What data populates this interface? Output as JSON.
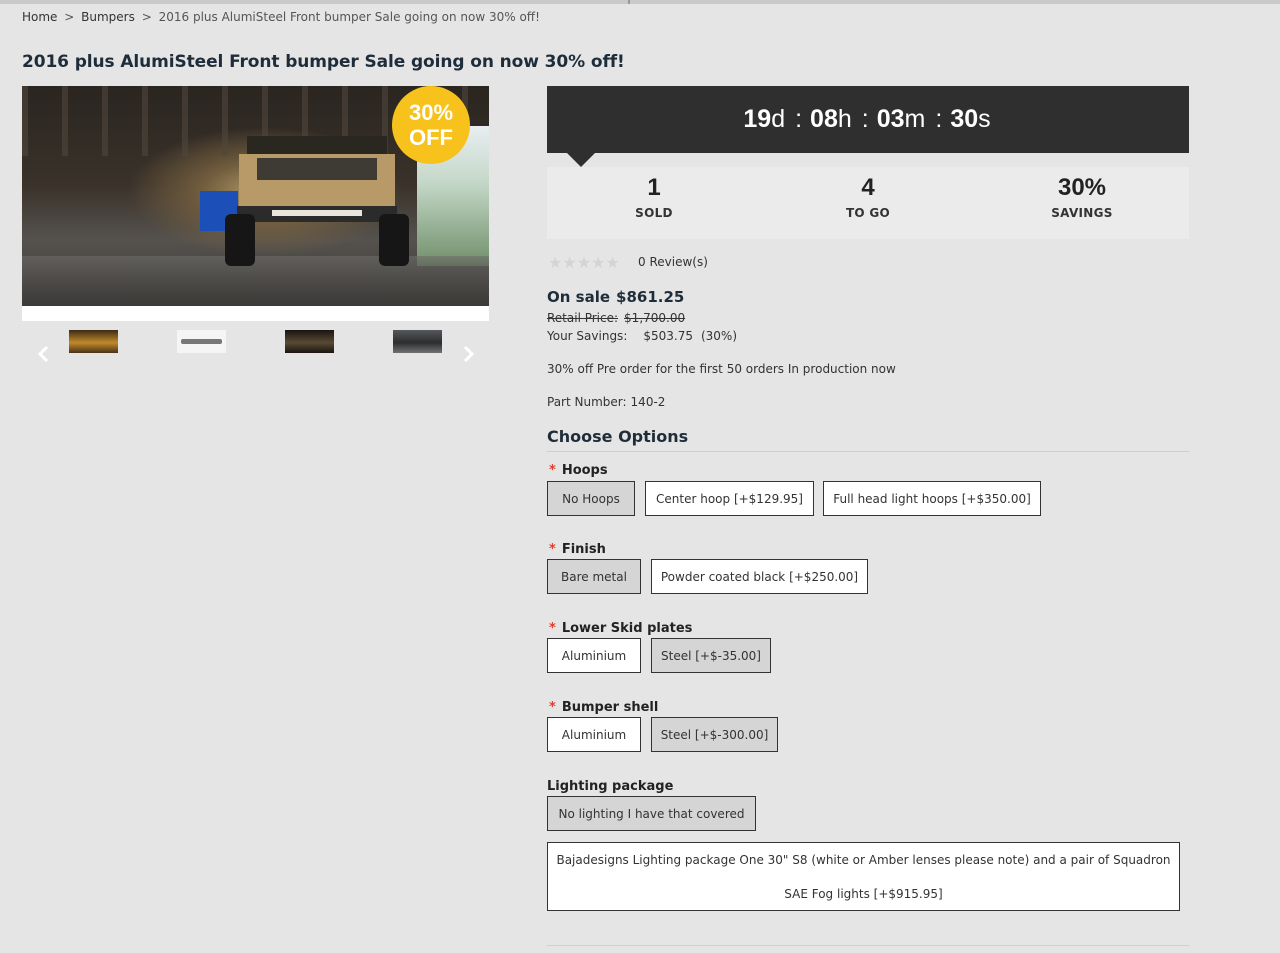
{
  "breadcrumb": {
    "home": "Home",
    "sep1": ">",
    "category": "Bumpers",
    "sep2": ">",
    "current": "2016 plus AlumiSteel Front bumper Sale going on now 30% off!"
  },
  "product": {
    "title": "2016 plus AlumiSteel Front bumper Sale going on now 30% off!",
    "badge_line1": "30%",
    "badge_line2": "OFF"
  },
  "gallery": {
    "prev_icon": "chevron-left-icon",
    "next_icon": "chevron-right-icon",
    "thumbnail_count": 4
  },
  "countdown": {
    "days": "19",
    "days_unit": "d",
    "hours": "08",
    "hours_unit": "h",
    "minutes": "03",
    "minutes_unit": "m",
    "seconds": "30",
    "seconds_unit": "s",
    "separator": ":"
  },
  "stats": [
    {
      "value": "1",
      "label": "SOLD"
    },
    {
      "value": "4",
      "label": "TO GO"
    },
    {
      "value": "30%",
      "label": "SAVINGS"
    }
  ],
  "rating": {
    "stars": "★★★★★",
    "stars_filled": 0,
    "reviews": "0 Review(s)"
  },
  "pricing": {
    "on_sale_label": "On sale",
    "on_sale_price": "$861.25",
    "retail_label": "Retail Price:",
    "retail_price": "$1,700.00",
    "savings_label": "Your Savings:",
    "savings_amount": "$503.75",
    "savings_percent": "(30%)"
  },
  "description": "30% off Pre order for the first 50 orders In production now",
  "part_number": {
    "label": "Part Number:",
    "value": "140-2"
  },
  "options": {
    "title": "Choose Options",
    "required_mark": "*",
    "hoops": {
      "label": "Hoops",
      "choices": [
        "No Hoops",
        "Center hoop [+$129.95]",
        "Full head light hoops [+$350.00]"
      ],
      "selected": "No Hoops"
    },
    "finish": {
      "label": "Finish",
      "choices": [
        "Bare metal",
        "Powder coated black [+$250.00]"
      ],
      "selected": "Bare metal"
    },
    "skid": {
      "label": "Lower Skid plates",
      "choices": [
        "Aluminium",
        "Steel [+$-35.00]"
      ],
      "selected": "Steel [+$-35.00]"
    },
    "shell": {
      "label": "Bumper shell",
      "choices": [
        "Aluminium",
        "Steel [+$-300.00]"
      ],
      "selected": "Steel [+$-300.00]"
    },
    "lighting": {
      "label": "Lighting package",
      "choice1": "No lighting I have that covered",
      "choice2_line1": "Bajadesigns Lighting package One 30\" S8 (white or Amber lenses please note) and a pair of Squadron",
      "choice2_line2": "SAE Fog lights [+$915.95]",
      "selected": "No lighting I have that covered"
    }
  },
  "colors": {
    "background": "#e5e5e5",
    "countdown_bg": "#2f2f2f",
    "badge": "#f7c21c",
    "required": "#e23b2b",
    "title": "#1f2d3a"
  }
}
